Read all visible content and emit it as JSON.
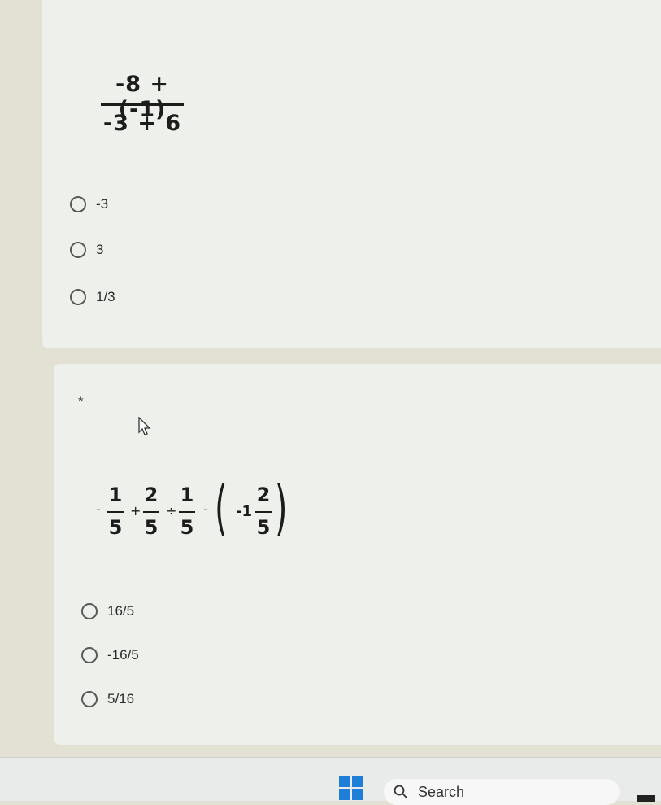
{
  "question1": {
    "expression": {
      "numerator": "-8 + (-1)",
      "denominator": "-3 + 6"
    },
    "options": [
      "-3",
      "3",
      "1/3"
    ]
  },
  "question2": {
    "required_mark": "*",
    "expression": {
      "lead_sign": "-",
      "terms": [
        {
          "num": "1",
          "den": "5"
        },
        {
          "op": "+"
        },
        {
          "num": "2",
          "den": "5"
        },
        {
          "op": "÷"
        },
        {
          "num": "1",
          "den": "5"
        },
        {
          "op": "-"
        },
        {
          "paren_open": "("
        },
        {
          "whole": "-1",
          "num": "2",
          "den": "5"
        },
        {
          "paren_close": ")"
        }
      ]
    },
    "options": [
      "16/5",
      "-16/5",
      "5/16"
    ]
  },
  "taskbar": {
    "search_label": "Search",
    "icons": [
      "windows-start-icon",
      "search-icon"
    ]
  }
}
